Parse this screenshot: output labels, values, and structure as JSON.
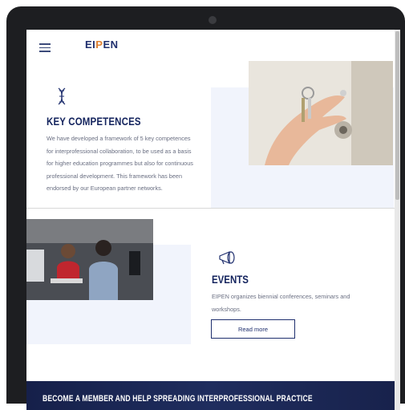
{
  "header": {
    "logo_parts": [
      "EI",
      "P",
      "EN"
    ]
  },
  "key_competences": {
    "icon": "dna-icon",
    "title": "KEY COMPETENCES",
    "text": "We have developed a framework of 5 key competences for interprofessional collaboration, to be used as a basis for higher education programmes but also for continuous professional development. This framework has been endorsed by our European partner networks.",
    "image": "hand-holding-keys-photo"
  },
  "events": {
    "icon": "megaphone-icon",
    "title": "EVENTS",
    "text": "EIPEN organizes biennial conferences, seminars and workshops.",
    "button_label": "Read more",
    "image": "people-at-computers-photo"
  },
  "banner": {
    "text": "BECOME A MEMBER AND HELP SPREADING INTERPROFESSIONAL PRACTICE"
  },
  "colors": {
    "navy": "#14245e",
    "accent": "#e08030",
    "panel": "#f1f4fc",
    "frame": "#1d1e21"
  }
}
